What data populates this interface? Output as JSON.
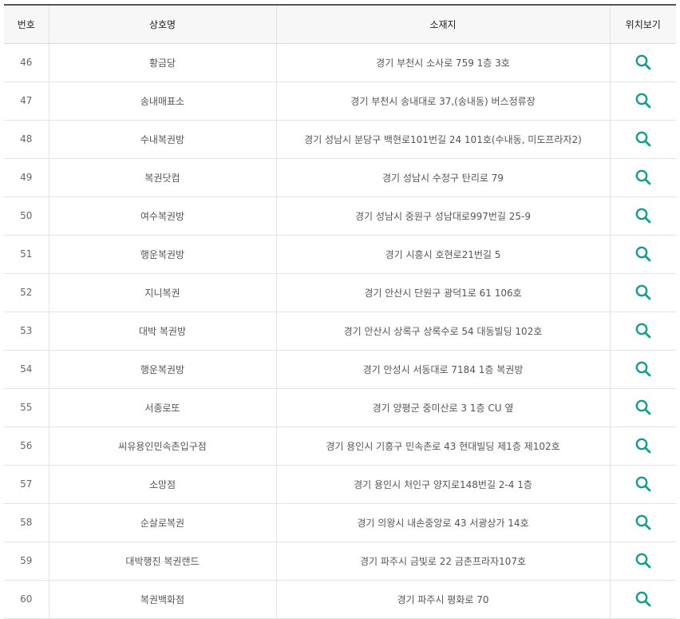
{
  "table": {
    "headers": {
      "number": "번호",
      "name": "상호명",
      "address": "소재지",
      "location": "위치보기"
    },
    "icon": "search-icon",
    "icon_color": "#1a9a8a",
    "rows": [
      {
        "number": "46",
        "name": "황금당",
        "address": "경기 부천시 소사로 759 1층 3호"
      },
      {
        "number": "47",
        "name": "송내매표소",
        "address": "경기 부천시 송내대로 37,(송내동) 버스정류장"
      },
      {
        "number": "48",
        "name": "수내복권방",
        "address": "경기 성남시 분당구 백현로101번길 24 101호(수내동, 미도프라자2)"
      },
      {
        "number": "49",
        "name": "복권닷컴",
        "address": "경기 성남시 수정구 탄리로 79"
      },
      {
        "number": "50",
        "name": "여수복권방",
        "address": "경기 성남시 중원구 성남대로997번길 25-9"
      },
      {
        "number": "51",
        "name": "행운복권방",
        "address": "경기 시흥시 호현로21번길 5"
      },
      {
        "number": "52",
        "name": "지니복권",
        "address": "경기 안산시 단원구 광덕1로 61 106호"
      },
      {
        "number": "53",
        "name": "대박 복권방",
        "address": "경기 안산시 상록구 상록수로 54 대동빌딩 102호"
      },
      {
        "number": "54",
        "name": "행운복권방",
        "address": "경기 안성시 서동대로 7184 1층 복권방"
      },
      {
        "number": "55",
        "name": "서종로또",
        "address": "경기 양평군 중미산로 3 1층 CU 옆"
      },
      {
        "number": "56",
        "name": "씨유용인민속촌입구점",
        "address": "경기 용인시 기흥구 민속촌로 43 현대빌딩 제1층 제102호"
      },
      {
        "number": "57",
        "name": "소망점",
        "address": "경기 용인시 처인구 양지로148번길 2-4 1층"
      },
      {
        "number": "58",
        "name": "순살로복권",
        "address": "경기 의왕시 내손중앙로 43 서광상가 14호"
      },
      {
        "number": "59",
        "name": "대박행진 복권랜드",
        "address": "경기 파주시 금빛로 22 금촌프라자107호"
      },
      {
        "number": "60",
        "name": "복권백화점",
        "address": "경기 파주시 평화로 70"
      }
    ]
  }
}
